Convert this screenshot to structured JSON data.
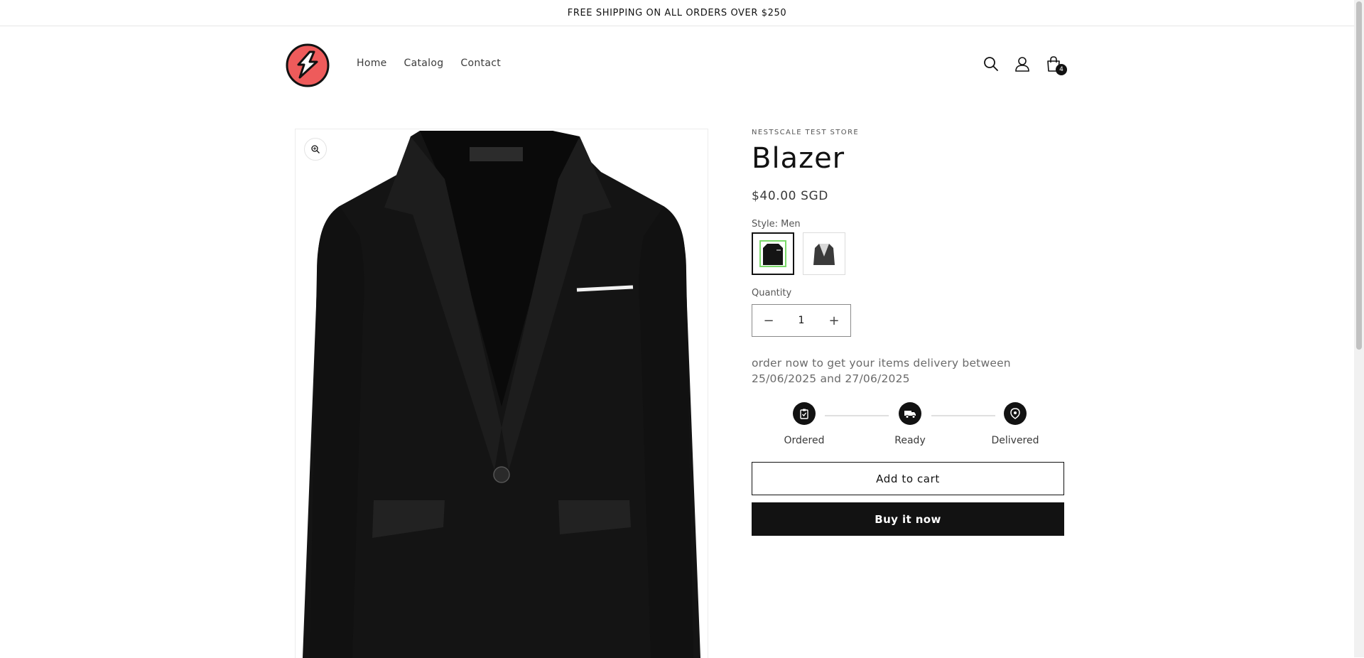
{
  "announcement": "FREE SHIPPING ON ALL ORDERS OVER $250",
  "brand": {
    "logo_color": "#ee5b5b"
  },
  "nav": [
    "Home",
    "Catalog",
    "Contact"
  ],
  "header_icons": [
    "search-icon",
    "account-icon",
    "cart-icon"
  ],
  "cart_count": "4",
  "product": {
    "vendor": "NESTSCALE TEST STORE",
    "title": "Blazer",
    "price": "$40.00 SGD",
    "style_label": "Style: Men",
    "quantity_label": "Quantity",
    "quantity_value": "1",
    "minus": "−",
    "plus": "+",
    "delivery_text": "order now to get your items delivery between 25/06/2025 and 27/06/2025",
    "timeline": [
      "Ordered",
      "Ready",
      "Delivered"
    ],
    "add_to_cart": "Add to cart",
    "buy_now": "Buy it now"
  }
}
